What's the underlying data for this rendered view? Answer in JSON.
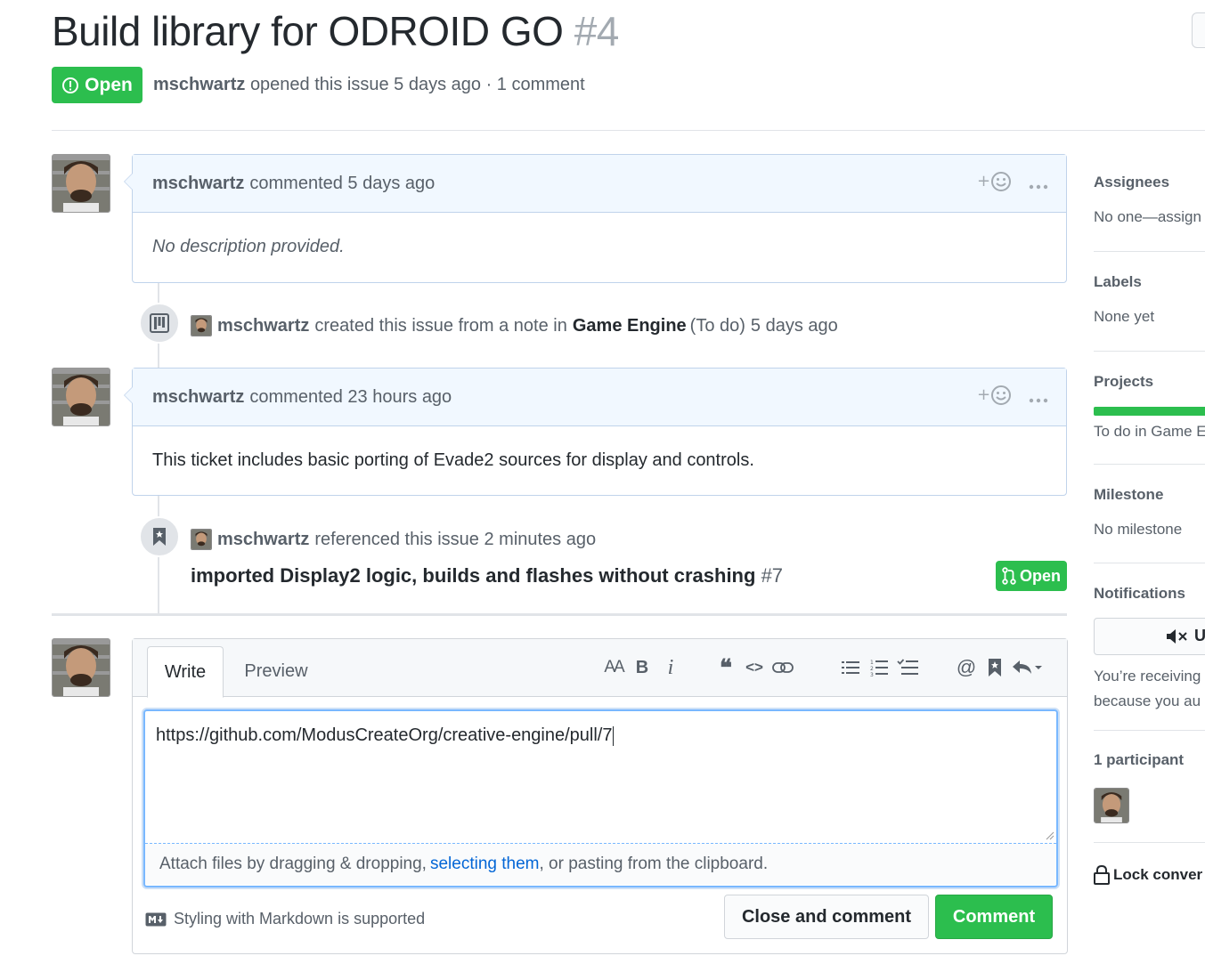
{
  "issue": {
    "title": "Build library for ODROID GO",
    "number": "#4",
    "state": "Open",
    "author": "mschwartz",
    "opened_text": "opened this issue 5 days ago · 1 comment"
  },
  "comments": [
    {
      "author": "mschwartz",
      "meta": "commented 5 days ago",
      "body": "No description provided."
    },
    {
      "author": "mschwartz",
      "meta": "commented 23 hours ago",
      "body": "This ticket includes basic porting of Evade2 sources for display and controls."
    }
  ],
  "events": {
    "project_note": {
      "user": "mschwartz",
      "text": "created this issue from a note in",
      "project": "Game Engine",
      "column": "(To do)",
      "time": "5 days ago"
    },
    "reference": {
      "user": "mschwartz",
      "text": "referenced this issue 2 minutes ago",
      "pr_title": "imported Display2 logic, builds and flashes without crashing",
      "pr_number": "#7",
      "pr_state": "Open"
    }
  },
  "editor": {
    "tab_write": "Write",
    "tab_preview": "Preview",
    "toolbar": {
      "header": "AA",
      "bold": "B",
      "italic": "i",
      "quote": "❝",
      "code": "<>",
      "mention": "@"
    },
    "text_value": "https://github.com/ModusCreateOrg/creative-engine/pull/7",
    "attach_prefix": "Attach files by dragging & dropping,",
    "attach_link": "selecting them",
    "attach_suffix": ", or pasting from the clipboard.",
    "markdown_note": "Styling with Markdown is supported",
    "close_button": "Close and comment",
    "comment_button": "Comment"
  },
  "sidebar": {
    "assignees": {
      "title": "Assignees",
      "value": "No one—assign"
    },
    "labels": {
      "title": "Labels",
      "value": "None yet"
    },
    "projects": {
      "title": "Projects",
      "value": "To do in Game E",
      "progress": 1.0
    },
    "milestone": {
      "title": "Milestone",
      "value": "No milestone"
    },
    "notifications": {
      "title": "Notifications",
      "button": "U",
      "text1": "You’re receiving",
      "text2": "because you au"
    },
    "participants": {
      "title": "1 participant"
    },
    "lock": {
      "label": "Lock conver"
    }
  },
  "colors": {
    "green": "#2cbe4e",
    "link": "#0366d6",
    "comment_header_bg": "#f1f8ff"
  }
}
